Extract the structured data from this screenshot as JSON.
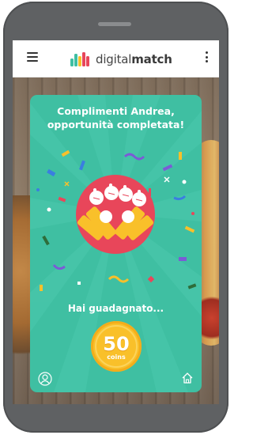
{
  "app": {
    "brand_prefix": "digital",
    "brand_suffix": "match",
    "logo_colors": [
      "#3fbfa2",
      "#f9c02a",
      "#e8465a"
    ]
  },
  "topbar": {
    "menu_icon": "hamburger-menu-icon",
    "more_icon": "vertical-dots-icon"
  },
  "congrats": {
    "line1": "Complimenti Andrea,",
    "line2": "opportunità completata!",
    "earned_label": "Hai guadagnato...",
    "coins_value": "50",
    "coins_unit": "coins",
    "accent": "#3fbfa2",
    "badge_color": "#e8465a",
    "coin_color": "#f9c02a"
  },
  "bottom_nav": {
    "left_icon": "user-profile-icon",
    "right_icon": "home-icon"
  }
}
